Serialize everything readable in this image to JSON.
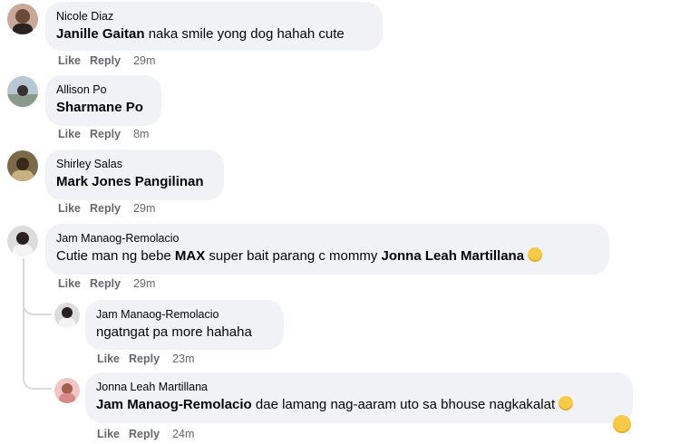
{
  "comments": [
    {
      "author": "Nicole Diaz",
      "mention": "Janille Gaitan",
      "text": " naka smile yong dog hahah cute",
      "like": "Like",
      "reply": "Reply",
      "time": "29m"
    },
    {
      "author": "Allison Po",
      "mention": "Sharmane Po",
      "text": "",
      "like": "Like",
      "reply": "Reply",
      "time": "8m"
    },
    {
      "author": "Shirley Salas",
      "mention": "Mark Jones Pangilinan",
      "text": "",
      "like": "Like",
      "reply": "Reply",
      "time": "29m"
    },
    {
      "author": "Jam Manaog-Remolacio",
      "text_pre": "Cutie man ng bebe ",
      "bold_mid": "MAX",
      "text_post": " super bait parang c mommy ",
      "mention": "Jonna Leah Martillana",
      "like": "Like",
      "reply": "Reply",
      "time": "29m"
    },
    {
      "author": "Jam Manaog-Remolacio",
      "text": "ngatngat pa more hahaha",
      "like": "Like",
      "reply": "Reply",
      "time": "23m"
    },
    {
      "author": "Jonna Leah Martillana",
      "mention": "Jam Manaog-Remolacio",
      "text": " dae lamang nag-aaram uto sa bhouse nagkakalat",
      "like": "Like",
      "reply": "Reply",
      "time": "24m"
    }
  ],
  "colors": {
    "bubble": "#f0f2f5",
    "meta": "#65676b",
    "text": "#050505"
  }
}
